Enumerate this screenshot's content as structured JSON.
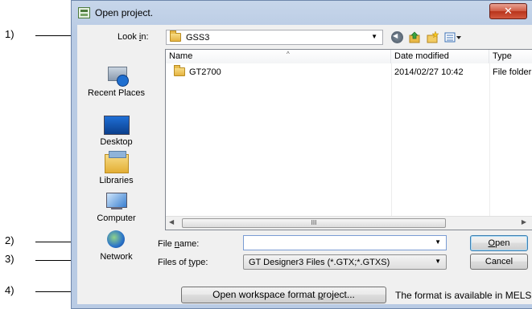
{
  "window": {
    "title": "Open project.",
    "close_glyph": "✕"
  },
  "callouts": [
    "1)",
    "2)",
    "3)",
    "4)"
  ],
  "lookin": {
    "label": "Look in:",
    "value": "GSS3",
    "arrow": "▼"
  },
  "toolbar_icons": [
    "back-icon",
    "up-folder-icon",
    "new-folder-icon",
    "views-menu-icon"
  ],
  "places": [
    {
      "label": "Recent Places",
      "icon": "recent-places-icon"
    },
    {
      "label": "Desktop",
      "icon": "desktop-icon"
    },
    {
      "label": "Libraries",
      "icon": "libraries-icon"
    },
    {
      "label": "Computer",
      "icon": "computer-icon"
    },
    {
      "label": "Network",
      "icon": "network-icon"
    }
  ],
  "filelist": {
    "columns": [
      "Name",
      "Date modified",
      "Type"
    ],
    "sort_caret": "^",
    "rows": [
      {
        "name": "GT2700",
        "date": "2014/02/27 10:42",
        "type": "File folder"
      }
    ],
    "scroll_left": "◀",
    "scroll_thumb": "III",
    "scroll_right": "▶"
  },
  "file_name": {
    "label": "File name:",
    "value": "",
    "arrow": "▼"
  },
  "file_type": {
    "label": "Files of type:",
    "value": "GT Designer3 Files (*.GTX;*.GTXS)",
    "arrow": "▼"
  },
  "buttons": {
    "open": "Open",
    "cancel": "Cancel",
    "workspace": "Open workspace format project..."
  },
  "workspace_note": "The format is available in MELS"
}
